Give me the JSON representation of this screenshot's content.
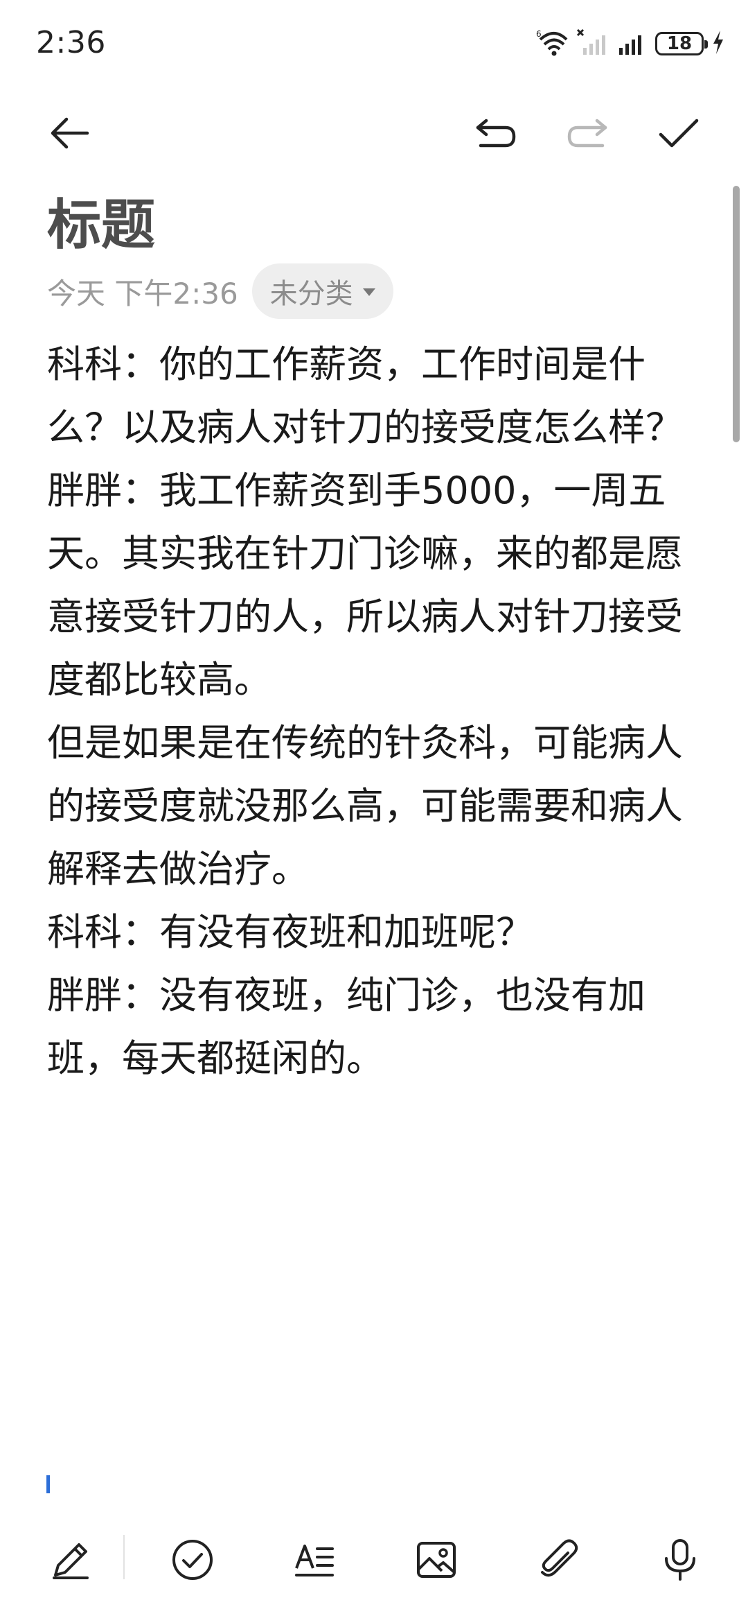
{
  "status_bar": {
    "time": "2:36",
    "battery_level": "18",
    "icons": [
      "wifi-icon",
      "signal-no-sim-icon",
      "signal-icon",
      "battery-icon",
      "charging-icon"
    ]
  },
  "toolbar": {
    "icons": [
      "back-arrow-icon",
      "undo-icon",
      "redo-icon",
      "checkmark-icon"
    ]
  },
  "note": {
    "title": "标题",
    "date": "今天 下午2:36",
    "category": "未分类",
    "paragraphs": [
      "科科：你的工作薪资，工作时间是什么？以及病人对针刀的接受度怎么样？",
      "",
      "胖胖：我工作薪资到手5000，一周五天。其实我在针刀门诊嘛，来的都是愿意接受针刀的人，所以病人对针刀接受度都比较高。",
      "",
      "但是如果是在传统的针灸科，可能病人的接受度就没那么高，可能需要和病人解释去做治疗。",
      "",
      "科科：有没有夜班和加班呢？",
      "胖胖：没有夜班，纯门诊，也没有加班，每天都挺闲的。"
    ]
  },
  "bottom_bar": {
    "icons": [
      "pen-icon",
      "checklist-icon",
      "text-format-icon",
      "image-icon",
      "attachment-icon",
      "microphone-icon"
    ]
  },
  "colors": {
    "accent": "#2c6ed8",
    "title": "#4d4d4d",
    "meta": "#9a9a9a",
    "chip_bg": "#eeeeee"
  }
}
